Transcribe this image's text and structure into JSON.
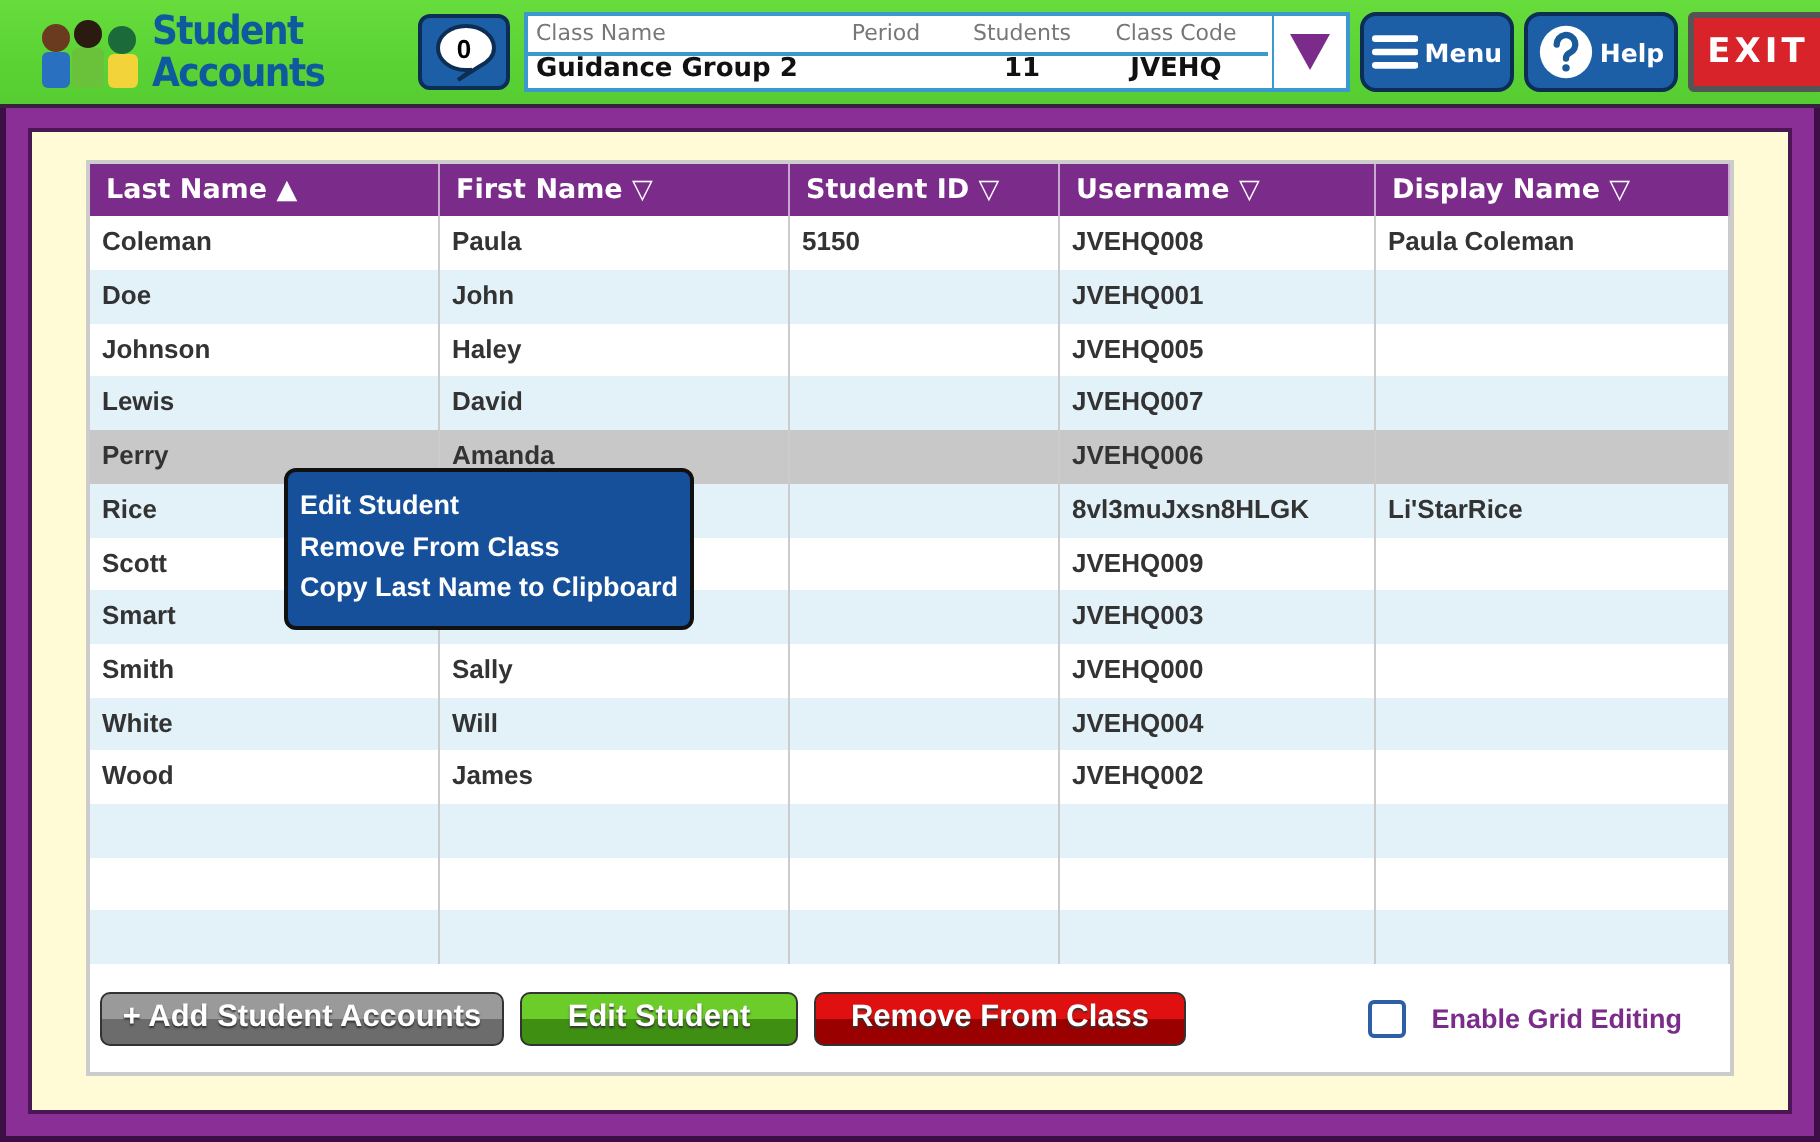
{
  "header": {
    "logo": [
      "Student",
      "Accounts"
    ],
    "messages": "0",
    "class_info": [
      {
        "label": "Class Name",
        "value": "Guidance Group 2"
      },
      {
        "label": "Period"
      },
      {
        "label": "Students",
        "value": "11"
      },
      {
        "label": "Class Code",
        "value": "JVEHQ"
      }
    ],
    "buttons": [
      {
        "kind": "menu",
        "label": "Menu"
      },
      {
        "kind": "help",
        "label": "Help"
      },
      {
        "kind": "exit",
        "label": "EXIT"
      }
    ]
  },
  "table": {
    "columns": [
      {
        "label": "Last Name",
        "sort": "▲"
      },
      {
        "label": "First Name",
        "sort": "▽"
      },
      {
        "label": "Student ID",
        "sort": "▽"
      },
      {
        "label": "Username",
        "sort": "▽"
      },
      {
        "label": "Display Name",
        "sort": "▽"
      }
    ],
    "rows": [
      {
        "cells": [
          "Coleman",
          "Paula",
          "5150",
          "JVEHQ008",
          "Paula Coleman"
        ],
        "selected": false
      },
      {
        "cells": [
          "Doe",
          "John",
          "",
          "JVEHQ001",
          ""
        ],
        "selected": false
      },
      {
        "cells": [
          "Johnson",
          "Haley",
          "",
          "JVEHQ005",
          ""
        ],
        "selected": false
      },
      {
        "cells": [
          "Lewis",
          "David",
          "",
          "JVEHQ007",
          ""
        ],
        "selected": false
      },
      {
        "cells": [
          "Perry",
          "Amanda",
          "",
          "JVEHQ006",
          ""
        ],
        "selected": true
      },
      {
        "cells": [
          "Rice",
          "",
          "",
          "8vl3muJxsn8HLGK",
          "Li'StarRice"
        ],
        "selected": false
      },
      {
        "cells": [
          "Scott",
          "",
          "",
          "JVEHQ009",
          ""
        ],
        "selected": false
      },
      {
        "cells": [
          "Smart",
          "",
          "",
          "JVEHQ003",
          ""
        ],
        "selected": false
      },
      {
        "cells": [
          "Smith",
          "Sally",
          "",
          "JVEHQ000",
          ""
        ],
        "selected": false
      },
      {
        "cells": [
          "White",
          "Will",
          "",
          "JVEHQ004",
          ""
        ],
        "selected": false
      },
      {
        "cells": [
          "Wood",
          "James",
          "",
          "JVEHQ002",
          ""
        ],
        "selected": false
      }
    ]
  },
  "context_menu": {
    "items": [
      "Edit Student",
      "Remove From Class",
      "Copy Last Name to Clipboard"
    ]
  },
  "footer": {
    "buttons": [
      {
        "kind": "gray",
        "label": "+ Add Student Accounts"
      },
      {
        "kind": "green",
        "label": "Edit Student"
      },
      {
        "kind": "red",
        "label": "Remove From Class"
      }
    ],
    "grid_editing": {
      "label": "Enable Grid Editing",
      "checked": false
    }
  }
}
